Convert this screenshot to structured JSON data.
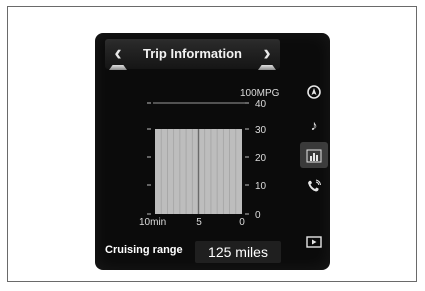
{
  "header": {
    "title": "Trip Information",
    "prev_icon": "chevron-left-icon",
    "next_icon": "chevron-right-icon"
  },
  "chart_data": {
    "type": "bar",
    "x_ticks": [
      "10min",
      "5",
      "0"
    ],
    "y_ticks": [
      "40",
      "30",
      "20",
      "10",
      "0"
    ],
    "y_max_label": "100MPG",
    "ylim": [
      0,
      40
    ],
    "grid": true
  },
  "sidebar": {
    "items": [
      {
        "icon": "navigation-icon"
      },
      {
        "icon": "music-note-icon"
      },
      {
        "icon": "bar-chart-icon",
        "active": true
      },
      {
        "icon": "phone-icon"
      },
      {
        "icon": "screen-off-icon"
      }
    ]
  },
  "footer": {
    "label": "Cruising range",
    "value": "125 miles"
  },
  "colors": {
    "screen_bg": "#0b0b0b",
    "grid_fill": "#bdbdbd",
    "text": "#ffffff"
  }
}
